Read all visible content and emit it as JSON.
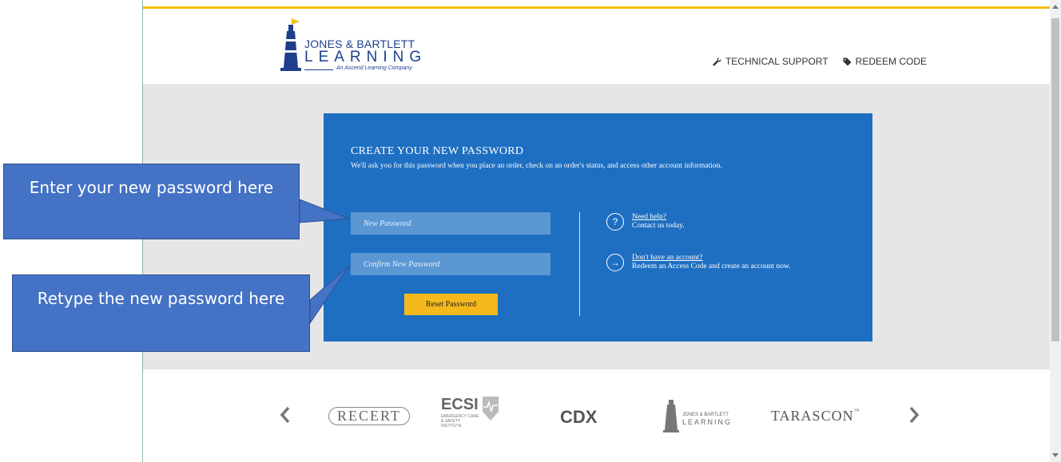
{
  "brand": {
    "name_line1": "JONES & BARTLETT",
    "name_line2": "LEARNING",
    "tagline": "An Ascend Learning Company",
    "accent_color": "#f3c012",
    "primary_color": "#1d3f8c"
  },
  "header": {
    "nav": [
      {
        "label": "TECHNICAL SUPPORT",
        "icon": "wrench-icon"
      },
      {
        "label": "REDEEM CODE",
        "icon": "tag-icon"
      }
    ]
  },
  "card": {
    "title": "CREATE YOUR NEW PASSWORD",
    "subtitle": "We'll ask you for this password when you place an order, check on an order's status, and access other account information.",
    "new_password_placeholder": "New Password",
    "confirm_password_placeholder": "Confirm New Password",
    "reset_label": "Reset Password",
    "background_color": "#1e6fc1",
    "button_color": "#f5b81d",
    "help": [
      {
        "icon": "question-circle-icon",
        "glyph": "?",
        "link": "Need help?",
        "text": "Contact us today."
      },
      {
        "icon": "arrow-right-circle-icon",
        "glyph": "→",
        "link": "Don't have an account?",
        "text": "Redeem an Access Code and create an account now."
      }
    ]
  },
  "callouts": [
    {
      "text": "Enter your new password here"
    },
    {
      "text": "Retype the new password here"
    }
  ],
  "carousel": {
    "brands": [
      {
        "name": "RECERT"
      },
      {
        "name": "ECSI",
        "sub": "EMERGENCY CARE & SAFETY INSTITUTE"
      },
      {
        "name": "CDX"
      },
      {
        "name_line1": "JONES & BARTLETT",
        "name_line2": "LEARNING"
      },
      {
        "name": "TARASCON",
        "mark": "™"
      }
    ]
  }
}
